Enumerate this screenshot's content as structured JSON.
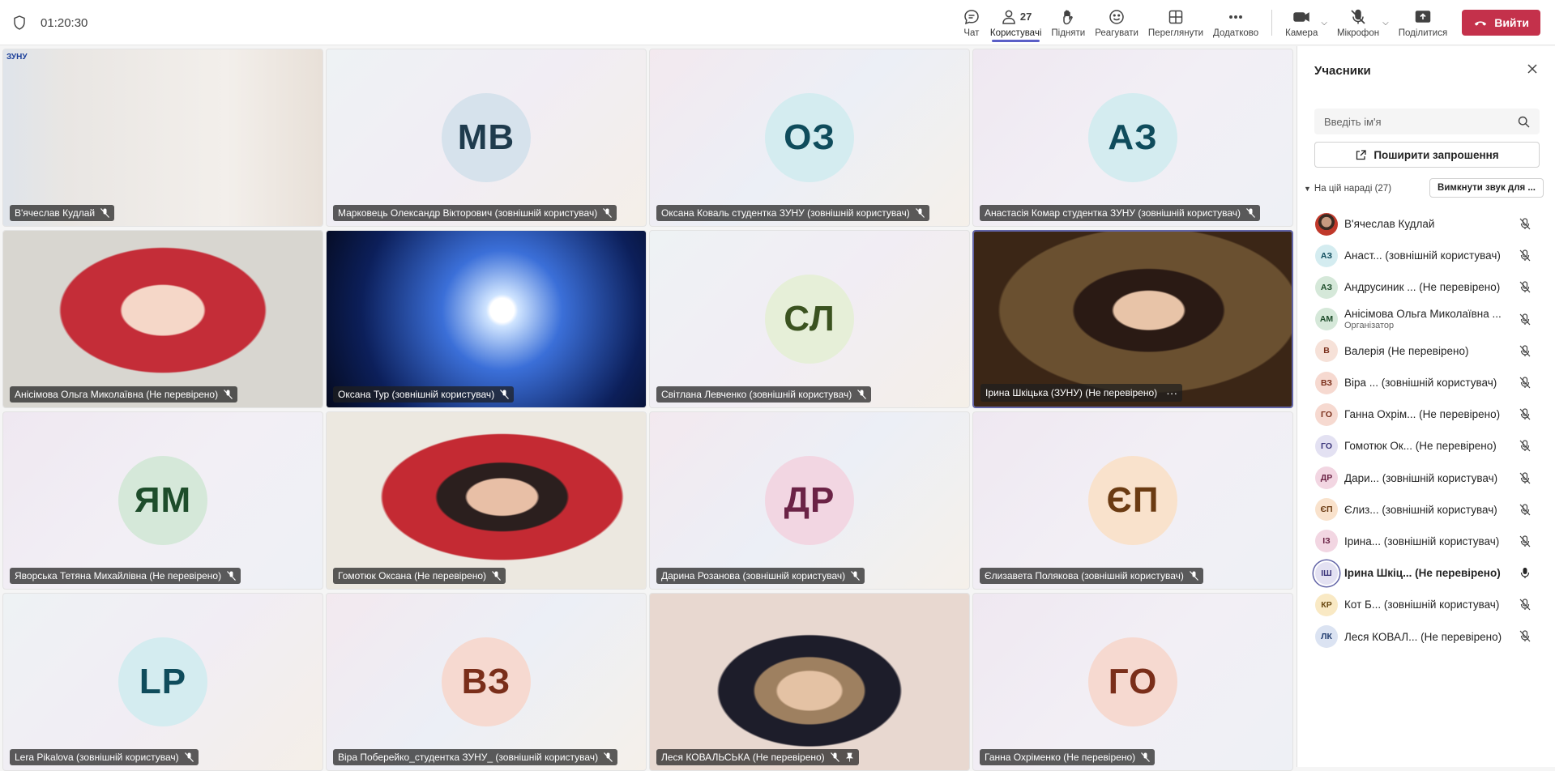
{
  "meeting": {
    "timer": "01:20:30"
  },
  "toolbar": {
    "chat": "Чат",
    "people": "Користувачі",
    "people_count": "27",
    "raise": "Підняти",
    "react": "Реагувати",
    "view": "Переглянути",
    "more": "Додатково",
    "camera": "Камера",
    "mic": "Мікрофон",
    "share": "Поділитися",
    "leave": "Вийти",
    "leave_color": "#c4314b",
    "accent": "#5b5fc7"
  },
  "tiles": [
    {
      "name": "В'ячеслав Кудлай",
      "type": "video",
      "brand": "ЗУНУ"
    },
    {
      "name": "Марковець Олександр Вікторович (зовнішній користувач)",
      "initials": "МВ",
      "bg": "#d6e2ec",
      "fg": "#1f3b4d"
    },
    {
      "name": "Оксана Коваль студентка ЗУНУ (зовнішній користувач)",
      "initials": "ОЗ",
      "bg": "#d4ecf0",
      "fg": "#0f4c5c"
    },
    {
      "name": "Анастасія Комар студентка ЗУНУ (зовнішній користувач)",
      "initials": "АЗ",
      "bg": "#d4ecf0",
      "fg": "#0f4c5c"
    },
    {
      "name": "Анісімова Ольга Миколаївна (Не перевірено)",
      "type": "video"
    },
    {
      "name": "Оксана Тур (зовнішній користувач)",
      "type": "video"
    },
    {
      "name": "Світлана Левченко (зовнішній користувач)",
      "initials": "СЛ",
      "bg": "#e6efd8",
      "fg": "#3b5320"
    },
    {
      "name": "Ірина Шкіцька (ЗУНУ) (Не перевірено)",
      "type": "video",
      "selected": true
    },
    {
      "name": "Яворська Тетяна Михайлівна (Не перевірено)",
      "initials": "ЯМ",
      "bg": "#d5e8d9",
      "fg": "#1e4d2b"
    },
    {
      "name": "Гомотюк Оксана (Не перевірено)",
      "type": "video"
    },
    {
      "name": "Дарина Розанова (зовнішній користувач)",
      "initials": "ДР",
      "bg": "#f2d6e2",
      "fg": "#6b2346"
    },
    {
      "name": "Єлизавета Полякова (зовнішній користувач)",
      "initials": "ЄП",
      "bg": "#f9e2cc",
      "fg": "#6b3b12"
    },
    {
      "name": "Lera Pikalova (зовнішній користувач)",
      "initials": "LP",
      "bg": "#d4ecf0",
      "fg": "#0f4c5c"
    },
    {
      "name": "Віра Поберейко_студентка ЗУНУ_ (зовнішній користувач)",
      "initials": "ВЗ",
      "bg": "#f6d9d0",
      "fg": "#7a2e1a"
    },
    {
      "name": "Леся КОВАЛЬСЬКА (Не перевірено)",
      "type": "video"
    },
    {
      "name": "Ганна Охріменко (Не перевірено)",
      "initials": "ГО",
      "bg": "#f6d9d0",
      "fg": "#7a2e1a"
    }
  ],
  "panel": {
    "title": "Учасники",
    "search_placeholder": "Введіть ім'я",
    "invite": "Поширити запрошення",
    "section": "На цій нараді (27)",
    "mute_all": "Вимкнути звук для ...",
    "participants": [
      {
        "initials": "",
        "name": "В'ячеслав Кудлай",
        "photo": true
      },
      {
        "initials": "АЗ",
        "name": "Анаст... (зовнішній користувач)",
        "bg": "#d4ecf0",
        "fg": "#0f4c5c"
      },
      {
        "initials": "АЗ",
        "name": "Андрусиник ... (Не перевірено)",
        "bg": "#d5e8d9",
        "fg": "#1e4d2b"
      },
      {
        "initials": "АМ",
        "name": "Анісімова Ольга Миколаївна ...",
        "sub": "Організатор",
        "bg": "#d5e8d9",
        "fg": "#1e4d2b"
      },
      {
        "initials": "В",
        "name": "Валерія (Не перевірено)",
        "bg": "#f6e1d8",
        "fg": "#7a2e1a"
      },
      {
        "initials": "ВЗ",
        "name": "Віра ... (зовнішній користувач)",
        "bg": "#f6d9d0",
        "fg": "#7a2e1a"
      },
      {
        "initials": "ГО",
        "name": "Ганна Охрім... (Не перевірено)",
        "bg": "#f6d9d0",
        "fg": "#7a2e1a"
      },
      {
        "initials": "ГО",
        "name": "Гомотюк Ок... (Не перевірено)",
        "bg": "#e3e1f2",
        "fg": "#3b357a"
      },
      {
        "initials": "ДР",
        "name": "Дари... (зовнішній користувач)",
        "bg": "#f2d6e2",
        "fg": "#6b2346"
      },
      {
        "initials": "ЄП",
        "name": "Єлиз... (зовнішній користувач)",
        "bg": "#f9e2cc",
        "fg": "#6b3b12"
      },
      {
        "initials": "ІЗ",
        "name": "Ірина... (зовнішній користувач)",
        "bg": "#f2d6e2",
        "fg": "#6b2346"
      },
      {
        "initials": "ІШ",
        "name": "Ірина Шкіц... (Не перевірено)",
        "bg": "#e3e1f2",
        "fg": "#3b357a",
        "bold": true,
        "speaking": true
      },
      {
        "initials": "КР",
        "name": "Кот Б... (зовнішній користувач)",
        "bg": "#f9e9c4",
        "fg": "#6b4a12"
      },
      {
        "initials": "ЛК",
        "name": "Леся КОВАЛ... (Не перевірено)",
        "bg": "#dbe3f2",
        "fg": "#1f3b6d"
      }
    ]
  }
}
